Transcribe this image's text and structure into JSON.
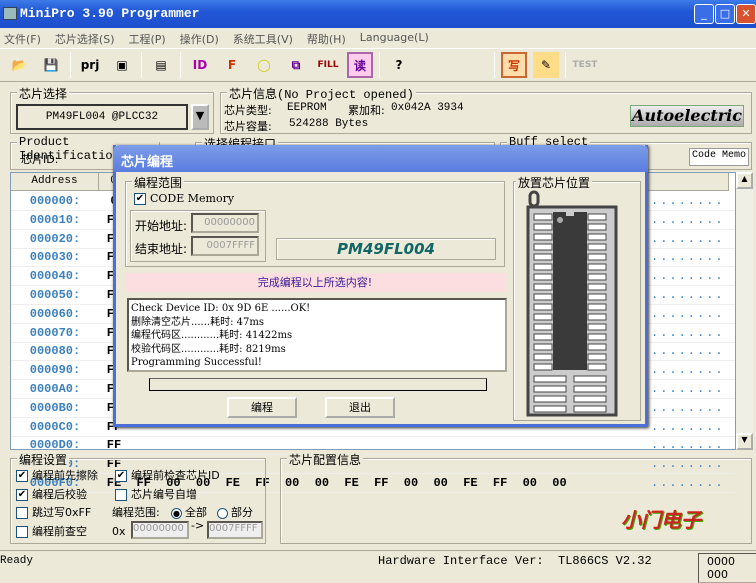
{
  "window": {
    "title": "MiniPro 3.90 Programmer"
  },
  "menu": [
    "文件(F)",
    "芯片选择(S)",
    "工程(P)",
    "操作(D)",
    "系统工具(V)",
    "帮助(H)",
    "Language(L)"
  ],
  "toolbar": {
    "icons": [
      "open-icon",
      "save-icon",
      "open-project-icon",
      "save-project-icon",
      "chip-icon",
      "read-id-icon",
      "blank-check-icon",
      "verify-icon",
      "edit-icon",
      "fill-icon",
      "read-icon",
      "help-icon",
      "write-icon",
      "edit-config-icon",
      "test-icon"
    ],
    "fill_label": "FILL",
    "read_label": "读",
    "write_label": "写",
    "test_label": "TEST",
    "help_label": "?",
    "prj_label": "prj",
    "id_label": "ID"
  },
  "chip_select": {
    "label": "芯片选择",
    "value": "PM49FL004   @PLCC32"
  },
  "chip_info": {
    "label": "芯片信息(No Project opened)",
    "type_label": "芯片类型:",
    "type_value": "EEPROM",
    "checksum_label": "累加和:",
    "checksum_value": "0x042A 3934",
    "size_label": "芯片容量:",
    "size_value": "524288 Bytes",
    "logo": "Autoelectric"
  },
  "product_id": {
    "label": "Product Identification",
    "id_label": "芯片ID:"
  },
  "interface": {
    "label": "选择编程接口"
  },
  "buff": {
    "label": "Buff select",
    "value": "Code Memo"
  },
  "hex": {
    "address_header": "Address",
    "col0_header": "0",
    "rows": [
      {
        "addr": "000000:",
        "first": "0"
      },
      {
        "addr": "000010:",
        "first": "FF"
      },
      {
        "addr": "000020:",
        "first": "FF"
      },
      {
        "addr": "000030:",
        "first": "FF"
      },
      {
        "addr": "000040:",
        "first": "FF"
      },
      {
        "addr": "000050:",
        "first": "FF"
      },
      {
        "addr": "000060:",
        "first": "FF"
      },
      {
        "addr": "000070:",
        "first": "FF"
      },
      {
        "addr": "000080:",
        "first": "FF"
      },
      {
        "addr": "000090:",
        "first": "FF"
      },
      {
        "addr": "0000A0:",
        "first": "FF"
      },
      {
        "addr": "0000B0:",
        "first": "FF"
      },
      {
        "addr": "0000C0:",
        "first": "FF"
      },
      {
        "addr": "0000D0:",
        "first": "FF"
      },
      {
        "addr": "0000E0:",
        "first": "FF"
      }
    ],
    "last_row": {
      "addr": "0000F0:",
      "bytes": [
        "FE",
        "FF",
        "00",
        "00",
        "FE",
        "FF",
        "00",
        "00",
        "FE",
        "FF",
        "00",
        "00",
        "FE",
        "FF",
        "00",
        "00"
      ]
    },
    "ascii": "........"
  },
  "dialog": {
    "title": "芯片编程",
    "range_label": "编程范围",
    "code_memory": "CODE Memory",
    "start_label": "开始地址:",
    "start_value": "00000000",
    "end_label": "结束地址:",
    "end_value": "0007FFFF",
    "chip_name": "PM49FL004",
    "banner": "完成编程以上所选内容!",
    "log": [
      "Check Device ID: 0x 9D 6E ......OK!",
      "删除清空芯片......耗时: 47ms",
      "编程代码区............耗时: 41422ms",
      "校验代码区............耗时: 8219ms",
      "Programming Successful!"
    ],
    "progress": 0,
    "program_button": "编程",
    "exit_button": "退出",
    "socket_label": "放置芯片位置"
  },
  "settings": {
    "label": "编程设置",
    "erase_before": "编程前先擦除",
    "check_id": "编程前检查芯片ID",
    "verify_after": "编程后校验",
    "auto_increment": "芯片编号自增",
    "skip_ff": "跳过写0xFF",
    "range_label": "编程范围:",
    "all": "全部",
    "partial": "部分",
    "blank_check": "编程前查空",
    "ox": "0x",
    "from": "00000000",
    "arrow": "->",
    "to": "0007FFFF"
  },
  "config": {
    "label": "芯片配置信息",
    "watermark": "小门电子"
  },
  "status": {
    "ready": "Ready",
    "hardware": "Hardware Interface Ver:  TL866CS V2.32",
    "counter": "0000 000"
  }
}
